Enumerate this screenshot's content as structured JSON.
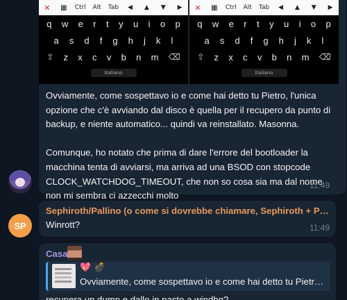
{
  "keyboard": {
    "toolbar": [
      "Ctrl",
      "Alt",
      "Tab"
    ],
    "row1": [
      "q",
      "w",
      "e",
      "r",
      "t",
      "y",
      "u",
      "i",
      "o",
      "p"
    ],
    "row2": [
      "a",
      "s",
      "d",
      "f",
      "g",
      "h",
      "j",
      "k",
      "l"
    ],
    "row3": [
      "z",
      "x",
      "c",
      "v",
      "b",
      "n",
      "m"
    ],
    "language": "Italiano"
  },
  "messages": [
    {
      "text_p1": "Ovviamente, come sospettavo io e come hai detto tu Pietro, l'unica opzione che c'è avviando dal disco è quella per il recupero da punto di backup, e niente automatico... quindi va reinstallato. Masonna.",
      "text_p2": "Comunque, ho notato che prima di dare l'errore del bootloader la macchina tenta di avviarsi, ma arriva ad una BSOD con stopcode CLOCK_WATCHDOG_TIMEOUT, che non so cosa sia ma dal nome non mi sembra ci azzecchi molto",
      "time": "11:49"
    },
    {
      "avatar_initials": "SP",
      "sender": "Sephiroth/Pallino (o come si dovrebbe chiamare, Sephiroth + Pallino)",
      "text": "Winrott?",
      "time": "11:49"
    },
    {
      "sender": "Casa",
      "reply_emoji_heart": "💖",
      "reply_emoji_bomb": "💣",
      "reply_text": "Ovviamente, come sospettavo io e come hai detto tu Pietro, l'unica opzione",
      "text": "recupera un dump e dallo in pasto a windbg?"
    }
  ],
  "colors": {
    "background": "#0e1621",
    "bubble": "#182533",
    "sender_orange": "#e6985a",
    "sender_purple": "#a695e7",
    "reply_bar": "#4ea4f5"
  }
}
